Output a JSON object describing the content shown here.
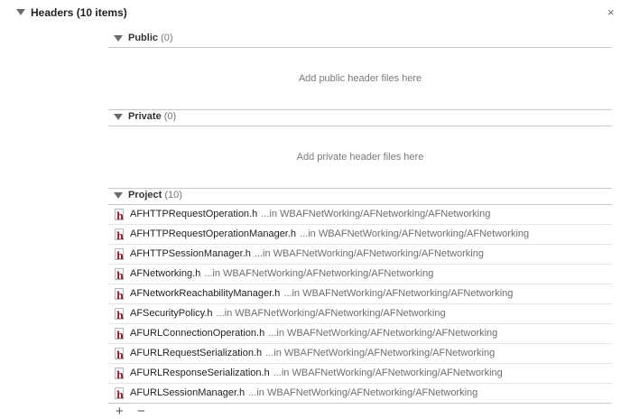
{
  "header": {
    "title": "Headers (10 items)",
    "close_label": "×"
  },
  "sections": {
    "public": {
      "title": "Public",
      "count": "(0)",
      "hint": "Add public header files here"
    },
    "private": {
      "title": "Private",
      "count": "(0)",
      "hint": "Add private header files here"
    },
    "project": {
      "title": "Project",
      "count": "(10)"
    }
  },
  "files": [
    {
      "name": "AFHTTPRequestOperation.h",
      "path": "...in WBAFNetWorking/AFNetworking/AFNetworking"
    },
    {
      "name": "AFHTTPRequestOperationManager.h",
      "path": "...in WBAFNetWorking/AFNetworking/AFNetworking"
    },
    {
      "name": "AFHTTPSessionManager.h",
      "path": "...in WBAFNetWorking/AFNetworking/AFNetworking"
    },
    {
      "name": "AFNetworking.h",
      "path": "...in WBAFNetWorking/AFNetworking/AFNetworking"
    },
    {
      "name": "AFNetworkReachabilityManager.h",
      "path": "...in WBAFNetWorking/AFNetworking/AFNetworking"
    },
    {
      "name": "AFSecurityPolicy.h",
      "path": "...in WBAFNetWorking/AFNetworking/AFNetworking"
    },
    {
      "name": "AFURLConnectionOperation.h",
      "path": "...in WBAFNetWorking/AFNetworking/AFNetworking"
    },
    {
      "name": "AFURLRequestSerialization.h",
      "path": "...in WBAFNetWorking/AFNetworking/AFNetworking"
    },
    {
      "name": "AFURLResponseSerialization.h",
      "path": "...in WBAFNetWorking/AFNetworking/AFNetworking"
    },
    {
      "name": "AFURLSessionManager.h",
      "path": "...in WBAFNetWorking/AFNetworking/AFNetworking"
    }
  ],
  "file_icon": {
    "name": "header-file-icon",
    "glyph": "h",
    "color": "#8a1d2b"
  },
  "toolbar": {
    "add_label": "+",
    "remove_label": "−"
  }
}
